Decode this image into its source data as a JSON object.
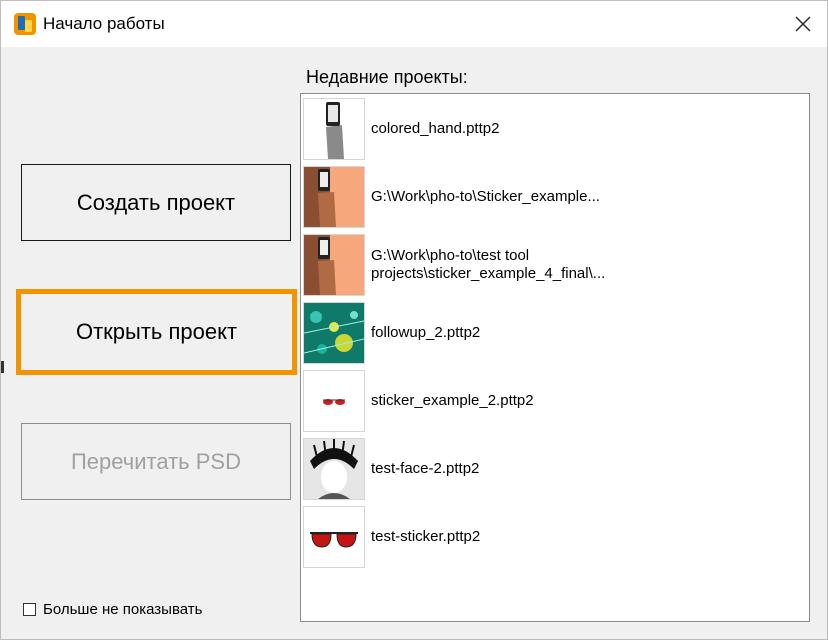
{
  "window": {
    "title": "Начало работы"
  },
  "buttons": {
    "create": "Создать проект",
    "open": "Открыть проект",
    "reread_psd": "Перечитать PSD"
  },
  "recent": {
    "heading": "Недавние проекты:",
    "items": [
      {
        "label": "colored_hand.pttp2",
        "thumb": "hand-phone-gray-thumbnail"
      },
      {
        "label": "G:\\Work\\pho-to\\Sticker_example...",
        "thumb": "hand-phone-orange-thumbnail"
      },
      {
        "label": "G:\\Work\\pho-to\\test tool\nprojects\\sticker_example_4_final\\...",
        "thumb": "hand-phone-orange-thumbnail"
      },
      {
        "label": "followup_2.pttp2",
        "thumb": "green-abstract-thumbnail"
      },
      {
        "label": "sticker_example_2.pttp2",
        "thumb": "small-sunglasses-thumbnail"
      },
      {
        "label": "test-face-2.pttp2",
        "thumb": "face-hair-thumbnail"
      },
      {
        "label": "test-sticker.pttp2",
        "thumb": "sunglasses-thumbnail"
      }
    ]
  },
  "dont_show_again": {
    "label": "Больше не показывать",
    "checked": false
  },
  "colors": {
    "accent": "#f29400",
    "disabled_text": "#a0a0a0"
  }
}
